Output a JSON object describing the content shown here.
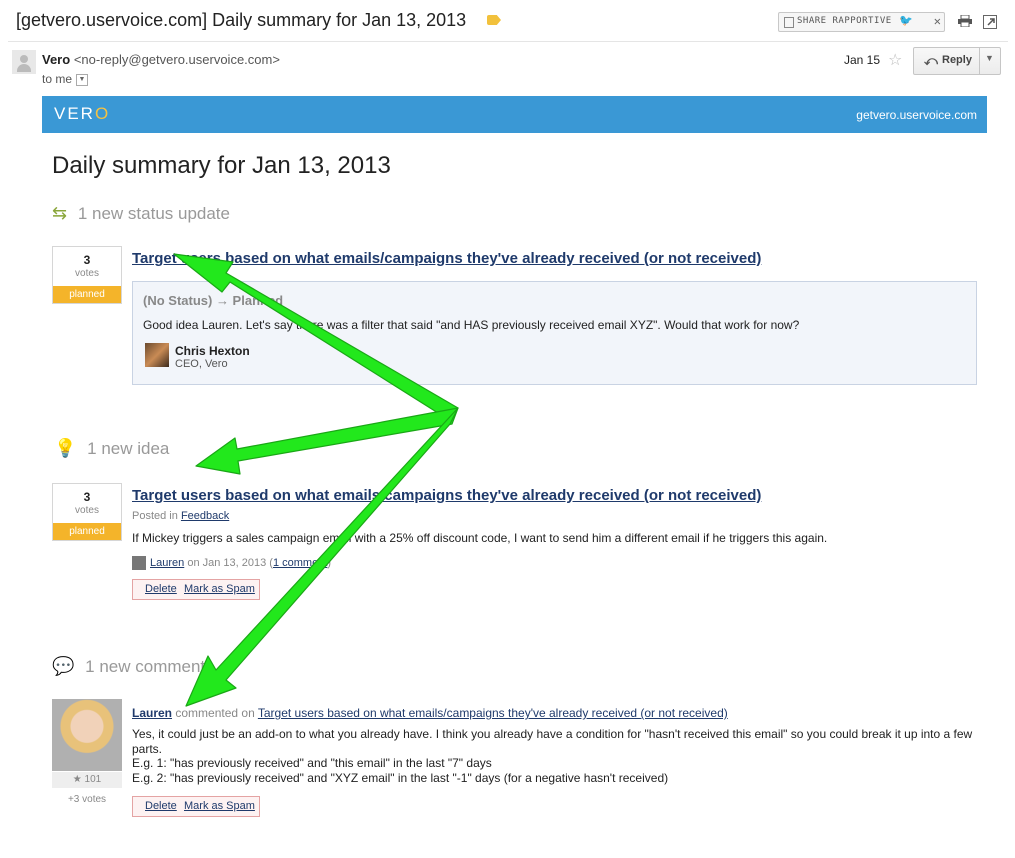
{
  "email": {
    "subject": "[getvero.uservoice.com] Daily summary for Jan 13, 2013",
    "sender_name": "Vero",
    "sender_email": "<no-reply@getvero.uservoice.com>",
    "to_line": "to me",
    "date": "Jan 15",
    "reply_label": "Reply",
    "share_label": "SHARE RAPPORTIVE"
  },
  "banner": {
    "logo_prefix": "VER",
    "logo_suffix": "O",
    "site": "getvero.uservoice.com"
  },
  "summary": {
    "title": "Daily summary for Jan 13, 2013",
    "status_section": {
      "heading": "1 new status update",
      "votes": "3",
      "votes_label": "votes",
      "status": "planned",
      "idea_title": "Target users based on what emails/campaigns they've already received (or not received)",
      "change": "(No Status) → Planned",
      "response": "Good idea Lauren. Let's say there was a filter that said \"and HAS previously received email XYZ\". Would that work for now?",
      "author": "Chris Hexton",
      "author_role": "CEO, Vero"
    },
    "idea_section": {
      "heading": "1 new idea",
      "votes": "3",
      "votes_label": "votes",
      "status": "planned",
      "idea_title": "Target users based on what emails/campaigns they've already received (or not received)",
      "posted_prefix": "Posted in",
      "category": "Feedback",
      "body": "If Mickey triggers a sales campaign email with a 25% off discount code, I want to send him a different email if he triggers this again.",
      "author": "Lauren",
      "on_date": "on Jan 13, 2013",
      "comments_link": "1 comment",
      "delete_label": "Delete",
      "spam_label": "Mark as Spam"
    },
    "comment_section": {
      "heading": "1 new comment",
      "commenter": "Lauren",
      "commented_on": "commented on",
      "idea_link": "Target users based on what emails/campaigns they've already received (or not received)",
      "body_lines": [
        "Yes, it could just be an add-on to what you already have. I think you already have a condition for \"hasn't received this email\" so you could break it up into a few parts.",
        "E.g. 1: \"has previously received\" and \"this email\" in the last \"7\" days",
        "E.g. 2: \"has previously received\" and \"XYZ email\" in the last \"-1\" days (for a negative hasn't received)"
      ],
      "karma": "★ 101",
      "votes": "+3 votes",
      "delete_label": "Delete",
      "spam_label": "Mark as Spam"
    }
  },
  "colors": {
    "banner": "#3a98d5",
    "planned": "#f4b42a",
    "annotation_arrow": "#22e81c"
  }
}
